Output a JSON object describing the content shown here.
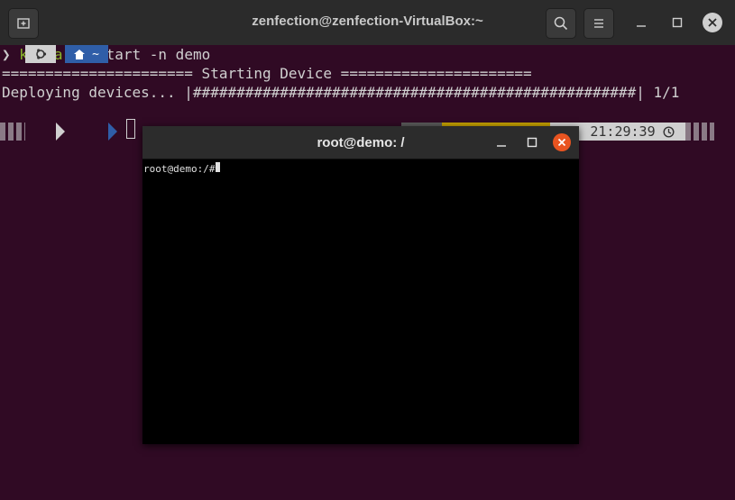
{
  "outer": {
    "title": "zenfection@zenfection-VirtualBox:~",
    "buttons": {
      "new_tab_icon": "new-tab-icon",
      "search_icon": "search-icon",
      "menu_icon": "hamburger-menu-icon"
    }
  },
  "terminal": {
    "prompt_arrow": "❯",
    "command_name": "kathara",
    "command_args": " vstart -n demo",
    "banner": "====================== Starting Device ======================",
    "progress": "Deploying devices... |###################################################| 1/1",
    "prompt_home": "~",
    "clock": "21:29:39"
  },
  "inner": {
    "title": "root@demo: /",
    "prompt": "root@demo:/# "
  },
  "colors": {
    "terminal_bg": "#300a24",
    "accent_orange": "#e95420",
    "command_green": "#8ab82a",
    "home_segment_blue": "#2f5ea8"
  }
}
